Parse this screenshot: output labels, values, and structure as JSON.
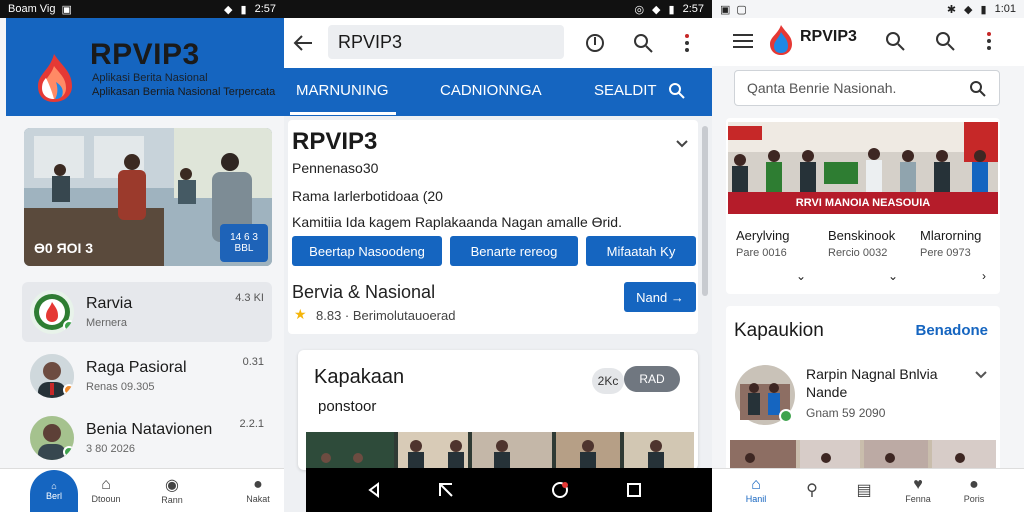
{
  "pane1": {
    "status": {
      "left": "Boam Vig",
      "right": "2:57"
    },
    "header": {
      "title": "RPVIP3",
      "subtitle1": "Aplikasi Berita Nasional",
      "subtitle2": "Aplikasan Bernia Nasional Terpercata"
    },
    "feature": {
      "label": "Ɵ0 ЯOI 3",
      "badge_line1": "14 6 3",
      "badge_line2": "BBL"
    },
    "list": [
      {
        "title": "Rarvia",
        "subtitle": "Mernera",
        "time": "4.3 KI"
      },
      {
        "title": "Raga Pasioral",
        "subtitle": "Renas 09.305",
        "time": "0.31"
      },
      {
        "title": "Benia Natavionen",
        "subtitle": "3 80 2026",
        "time": "2.2.1"
      }
    ],
    "nav": {
      "home": "Berl",
      "explore": "Dtooun",
      "video": "Rann",
      "profile": "Nakat"
    }
  },
  "pane2": {
    "status": {
      "time": "2:57"
    },
    "search_value": "RPVIP3",
    "tabs": [
      "MARNUNING",
      "CADNIONNGA",
      "SEALDIT"
    ],
    "card": {
      "title": "RPVIP3",
      "line1": "Pennenaso30",
      "line2": "Rama Iarlerbotidoaa (20",
      "line3": "Kamitiia Ida kagem Raplakaanda Nagan amalle Ɵrid.",
      "buttons": [
        "Beertap Nasoodeng",
        "Benarte rereog",
        "Mifaatah Ky"
      ],
      "sub_title": "Bervia & Nasional",
      "rating_text": "8.83 · Berimolutauoerad",
      "go_button": "Nand →"
    },
    "card2": {
      "title": "Kapakaan",
      "subtitle": "ponstoor",
      "pill1": "2Kc",
      "pill2": "RAD"
    }
  },
  "pane3": {
    "status": {
      "time": "1:01"
    },
    "title": "RPVIP3",
    "search_placeholder": "Qanta  Benrie Nasionah.",
    "banner_text": "RRVI MANOIA NEASOUIA",
    "stats": [
      {
        "title": "Aerylving",
        "sub": "Pare 0016"
      },
      {
        "title": "Benskinook",
        "sub": "Rercio 0032"
      },
      {
        "title": "Mlarorning",
        "sub": "Pere 0973"
      }
    ],
    "section": {
      "title": "Kapaukion",
      "link": "Benadone"
    },
    "item": {
      "title": "Rarpin Nagnal Bnlvia",
      "title2": "Nande",
      "sub": "Gnam 59 2090"
    },
    "nav": [
      "Hanil",
      "",
      "",
      "Fenna",
      "Poris"
    ]
  },
  "colors": {
    "primary": "#1565c0",
    "danger": "#b51c2a",
    "accent_green": "#3fa34d"
  }
}
